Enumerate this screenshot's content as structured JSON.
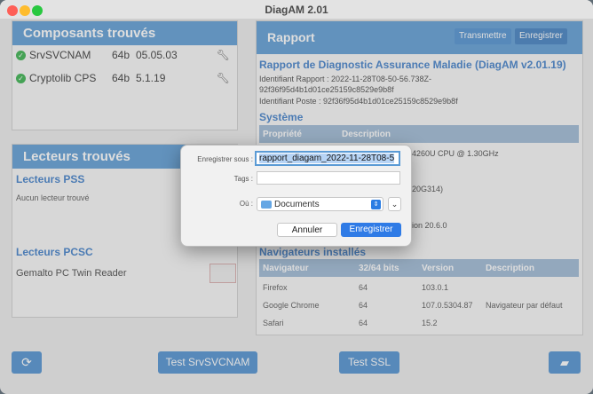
{
  "window": {
    "title": "DiagAM 2.01"
  },
  "components": {
    "header": "Composants trouvés",
    "items": [
      {
        "name": "SrvSVCNAM",
        "arch": "64b",
        "version": "05.05.03"
      },
      {
        "name": "Cryptolib CPS",
        "arch": "64b",
        "version": "5.1.19"
      }
    ]
  },
  "readers": {
    "header": "Lecteurs trouvés",
    "pss_title": "Lecteurs PSS",
    "pss_empty": "Aucun lecteur trouvé",
    "pcsc_title": "Lecteurs PCSC",
    "pcsc_item": "Gemalto PC Twin Reader"
  },
  "report": {
    "header": "Rapport",
    "transmit_label": "Transmettre",
    "save_label": "Enregistrer",
    "title": "Rapport de Diagnostic Assurance Maladie (DiagAM v2.01.19)",
    "id_rapport_line1": "Identifiant Rapport : 2022-11-28T08-50-56.738Z-",
    "id_rapport_line2": "92f36f95d4b1d01ce25159c8529e9b8f",
    "id_poste": "Identifiant Poste : 92f36f95d4b1d01ce25159c8529e9b8f",
    "system_title": "Système",
    "system_headers": {
      "prop": "Propriété",
      "desc": "Description"
    },
    "partial_cpu": "4260U CPU @ 1.30GHz",
    "partial_build": "20G314)",
    "partial_version": "ion 20.6.0",
    "browsers_title": "Navigateurs installés",
    "browser_headers": {
      "nav": "Navigateur",
      "bits": "32/64 bits",
      "version": "Version",
      "desc": "Description"
    },
    "browsers": [
      {
        "name": "Firefox",
        "bits": "64",
        "version": "103.0.1",
        "desc": ""
      },
      {
        "name": "Google Chrome",
        "bits": "64",
        "version": "107.0.5304.87",
        "desc": "Navigateur par défaut"
      },
      {
        "name": "Safari",
        "bits": "64",
        "version": "15.2",
        "desc": ""
      }
    ]
  },
  "bottom": {
    "test_srv_label": "Test SrvSVCNAM",
    "test_ssl_label": "Test SSL"
  },
  "dialog": {
    "save_as_label": "Enregistrer sous :",
    "filename_value": "rapport_diagam_2022-11-28T08-5",
    "tags_label": "Tags :",
    "tags_value": "",
    "where_label": "Où :",
    "where_value": "Documents",
    "cancel_label": "Annuler",
    "save_label": "Enregistrer"
  },
  "colors": {
    "accent": "#5b9bd5",
    "button": "#4d8fd0",
    "success": "#34b04a"
  },
  "icons": [
    "check-icon",
    "wrench-icon",
    "refresh-icon",
    "folder-open-icon",
    "folder-icon",
    "chevron-updown-icon",
    "chevron-down-icon"
  ]
}
